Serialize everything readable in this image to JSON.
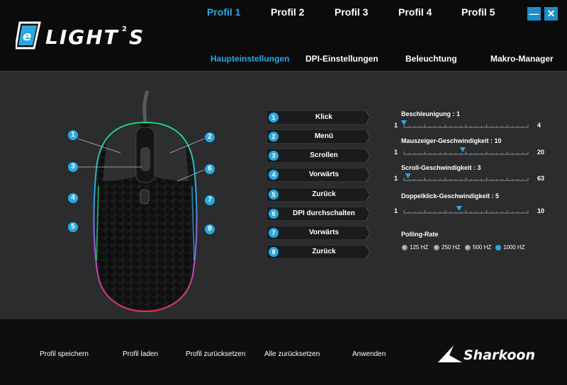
{
  "app": {
    "title": "LIGHT²S",
    "brand": "Sharkoon"
  },
  "profiles": [
    {
      "label": "Profil 1",
      "active": true
    },
    {
      "label": "Profil 2",
      "active": false
    },
    {
      "label": "Profil 3",
      "active": false
    },
    {
      "label": "Profil 4",
      "active": false
    },
    {
      "label": "Profil 5",
      "active": false
    }
  ],
  "window_controls": {
    "minimize": "—",
    "close": "✕"
  },
  "subtabs": [
    {
      "label": "Haupteinstellungen",
      "active": true
    },
    {
      "label": "DPI-Einstellungen",
      "active": false
    },
    {
      "label": "Beleuchtung",
      "active": false
    },
    {
      "label": "Makro-Manager",
      "active": false
    }
  ],
  "callouts": [
    "1",
    "2",
    "3",
    "4",
    "5",
    "6",
    "7",
    "8"
  ],
  "buttons": [
    {
      "num": "1",
      "label": "Klick"
    },
    {
      "num": "2",
      "label": "Menü"
    },
    {
      "num": "3",
      "label": "Scrollen"
    },
    {
      "num": "4",
      "label": "Vorwärts"
    },
    {
      "num": "5",
      "label": "Zurück"
    },
    {
      "num": "6",
      "label": "DPI durchschalten"
    },
    {
      "num": "7",
      "label": "Vorwärts"
    },
    {
      "num": "8",
      "label": "Zurück"
    }
  ],
  "sliders": [
    {
      "label": "Beschleunigung : 1",
      "min": "1",
      "max": "4",
      "value": 1,
      "min_value": 1,
      "max_value": 4
    },
    {
      "label": "Mauszeiger-Geschwindigkeit : 10",
      "min": "1",
      "max": "20",
      "value": 10,
      "min_value": 1,
      "max_value": 20
    },
    {
      "label": "Scroll-Geschwindigkeit : 3",
      "min": "1",
      "max": "63",
      "value": 3,
      "min_value": 1,
      "max_value": 63
    },
    {
      "label": "Doppelklick-Geschwindigkeit : 5",
      "min": "1",
      "max": "10",
      "value": 5,
      "min_value": 1,
      "max_value": 10
    }
  ],
  "polling": {
    "title": "Polling-Rate",
    "options": [
      {
        "label": "125 HZ",
        "selected": false
      },
      {
        "label": "250 HZ",
        "selected": false
      },
      {
        "label": "500 HZ",
        "selected": false
      },
      {
        "label": "1000 HZ",
        "selected": true
      }
    ]
  },
  "footer": [
    "Profil speichern",
    "Profil laden",
    "Profil zurücksetzen",
    "Alle zurücksetzen",
    "Anwenden"
  ],
  "colors": {
    "accent": "#29a9e1",
    "panel": "#2b2c2e",
    "header": "#0b0b0c"
  }
}
